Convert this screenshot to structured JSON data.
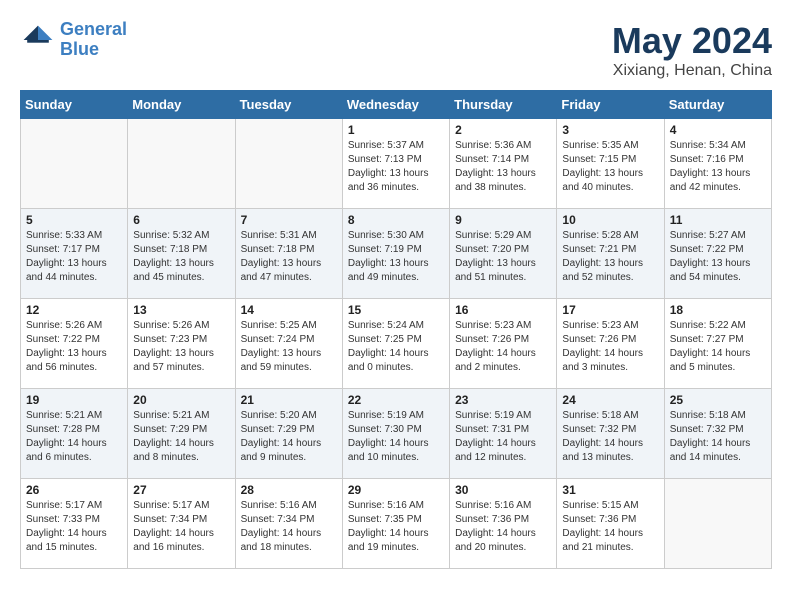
{
  "header": {
    "logo_line1": "General",
    "logo_line2": "Blue",
    "month_title": "May 2024",
    "location": "Xixiang, Henan, China"
  },
  "days_of_week": [
    "Sunday",
    "Monday",
    "Tuesday",
    "Wednesday",
    "Thursday",
    "Friday",
    "Saturday"
  ],
  "weeks": [
    [
      {
        "num": "",
        "info": ""
      },
      {
        "num": "",
        "info": ""
      },
      {
        "num": "",
        "info": ""
      },
      {
        "num": "1",
        "info": "Sunrise: 5:37 AM\nSunset: 7:13 PM\nDaylight: 13 hours\nand 36 minutes."
      },
      {
        "num": "2",
        "info": "Sunrise: 5:36 AM\nSunset: 7:14 PM\nDaylight: 13 hours\nand 38 minutes."
      },
      {
        "num": "3",
        "info": "Sunrise: 5:35 AM\nSunset: 7:15 PM\nDaylight: 13 hours\nand 40 minutes."
      },
      {
        "num": "4",
        "info": "Sunrise: 5:34 AM\nSunset: 7:16 PM\nDaylight: 13 hours\nand 42 minutes."
      }
    ],
    [
      {
        "num": "5",
        "info": "Sunrise: 5:33 AM\nSunset: 7:17 PM\nDaylight: 13 hours\nand 44 minutes."
      },
      {
        "num": "6",
        "info": "Sunrise: 5:32 AM\nSunset: 7:18 PM\nDaylight: 13 hours\nand 45 minutes."
      },
      {
        "num": "7",
        "info": "Sunrise: 5:31 AM\nSunset: 7:18 PM\nDaylight: 13 hours\nand 47 minutes."
      },
      {
        "num": "8",
        "info": "Sunrise: 5:30 AM\nSunset: 7:19 PM\nDaylight: 13 hours\nand 49 minutes."
      },
      {
        "num": "9",
        "info": "Sunrise: 5:29 AM\nSunset: 7:20 PM\nDaylight: 13 hours\nand 51 minutes."
      },
      {
        "num": "10",
        "info": "Sunrise: 5:28 AM\nSunset: 7:21 PM\nDaylight: 13 hours\nand 52 minutes."
      },
      {
        "num": "11",
        "info": "Sunrise: 5:27 AM\nSunset: 7:22 PM\nDaylight: 13 hours\nand 54 minutes."
      }
    ],
    [
      {
        "num": "12",
        "info": "Sunrise: 5:26 AM\nSunset: 7:22 PM\nDaylight: 13 hours\nand 56 minutes."
      },
      {
        "num": "13",
        "info": "Sunrise: 5:26 AM\nSunset: 7:23 PM\nDaylight: 13 hours\nand 57 minutes."
      },
      {
        "num": "14",
        "info": "Sunrise: 5:25 AM\nSunset: 7:24 PM\nDaylight: 13 hours\nand 59 minutes."
      },
      {
        "num": "15",
        "info": "Sunrise: 5:24 AM\nSunset: 7:25 PM\nDaylight: 14 hours\nand 0 minutes."
      },
      {
        "num": "16",
        "info": "Sunrise: 5:23 AM\nSunset: 7:26 PM\nDaylight: 14 hours\nand 2 minutes."
      },
      {
        "num": "17",
        "info": "Sunrise: 5:23 AM\nSunset: 7:26 PM\nDaylight: 14 hours\nand 3 minutes."
      },
      {
        "num": "18",
        "info": "Sunrise: 5:22 AM\nSunset: 7:27 PM\nDaylight: 14 hours\nand 5 minutes."
      }
    ],
    [
      {
        "num": "19",
        "info": "Sunrise: 5:21 AM\nSunset: 7:28 PM\nDaylight: 14 hours\nand 6 minutes."
      },
      {
        "num": "20",
        "info": "Sunrise: 5:21 AM\nSunset: 7:29 PM\nDaylight: 14 hours\nand 8 minutes."
      },
      {
        "num": "21",
        "info": "Sunrise: 5:20 AM\nSunset: 7:29 PM\nDaylight: 14 hours\nand 9 minutes."
      },
      {
        "num": "22",
        "info": "Sunrise: 5:19 AM\nSunset: 7:30 PM\nDaylight: 14 hours\nand 10 minutes."
      },
      {
        "num": "23",
        "info": "Sunrise: 5:19 AM\nSunset: 7:31 PM\nDaylight: 14 hours\nand 12 minutes."
      },
      {
        "num": "24",
        "info": "Sunrise: 5:18 AM\nSunset: 7:32 PM\nDaylight: 14 hours\nand 13 minutes."
      },
      {
        "num": "25",
        "info": "Sunrise: 5:18 AM\nSunset: 7:32 PM\nDaylight: 14 hours\nand 14 minutes."
      }
    ],
    [
      {
        "num": "26",
        "info": "Sunrise: 5:17 AM\nSunset: 7:33 PM\nDaylight: 14 hours\nand 15 minutes."
      },
      {
        "num": "27",
        "info": "Sunrise: 5:17 AM\nSunset: 7:34 PM\nDaylight: 14 hours\nand 16 minutes."
      },
      {
        "num": "28",
        "info": "Sunrise: 5:16 AM\nSunset: 7:34 PM\nDaylight: 14 hours\nand 18 minutes."
      },
      {
        "num": "29",
        "info": "Sunrise: 5:16 AM\nSunset: 7:35 PM\nDaylight: 14 hours\nand 19 minutes."
      },
      {
        "num": "30",
        "info": "Sunrise: 5:16 AM\nSunset: 7:36 PM\nDaylight: 14 hours\nand 20 minutes."
      },
      {
        "num": "31",
        "info": "Sunrise: 5:15 AM\nSunset: 7:36 PM\nDaylight: 14 hours\nand 21 minutes."
      },
      {
        "num": "",
        "info": ""
      }
    ]
  ]
}
